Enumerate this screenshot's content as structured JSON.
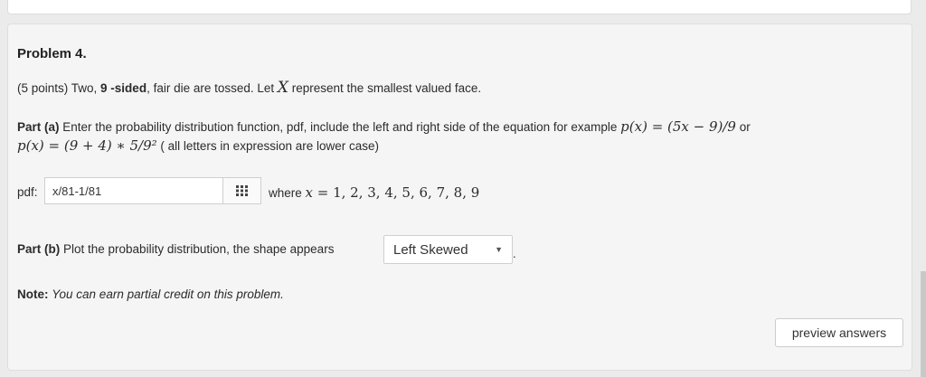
{
  "problem": {
    "title": "Problem 4.",
    "intro": {
      "prefix": "(5 points) Two, ",
      "bold": "9 -sided",
      "middle": ", fair die are tossed. Let ",
      "var": "X",
      "suffix": " represent the smallest valued face."
    },
    "part_a": {
      "label": "Part (a)",
      "text": " Enter the probability distribution function, pdf, include the left and right side of the equation for example ",
      "example1": "p(x) = (5x − 9)/9",
      "or": " or",
      "example2": "p(x) = (9 + 4) ∗ 5/9²",
      "note": " ( all letters in expression are lower case)"
    },
    "pdf": {
      "label": "pdf:",
      "value": "x/81-1/81",
      "where": "where ",
      "domain_var": "x",
      "domain_values": " = 1, 2, 3, 4, 5, 6, 7, 8, 9"
    },
    "part_b": {
      "label": "Part (b)",
      "text": " Plot the probability distribution, the shape appears",
      "selected": "Left Skewed"
    },
    "note": {
      "label": "Note:",
      "text": "You can earn partial credit on this problem."
    },
    "preview_button": "preview answers"
  }
}
